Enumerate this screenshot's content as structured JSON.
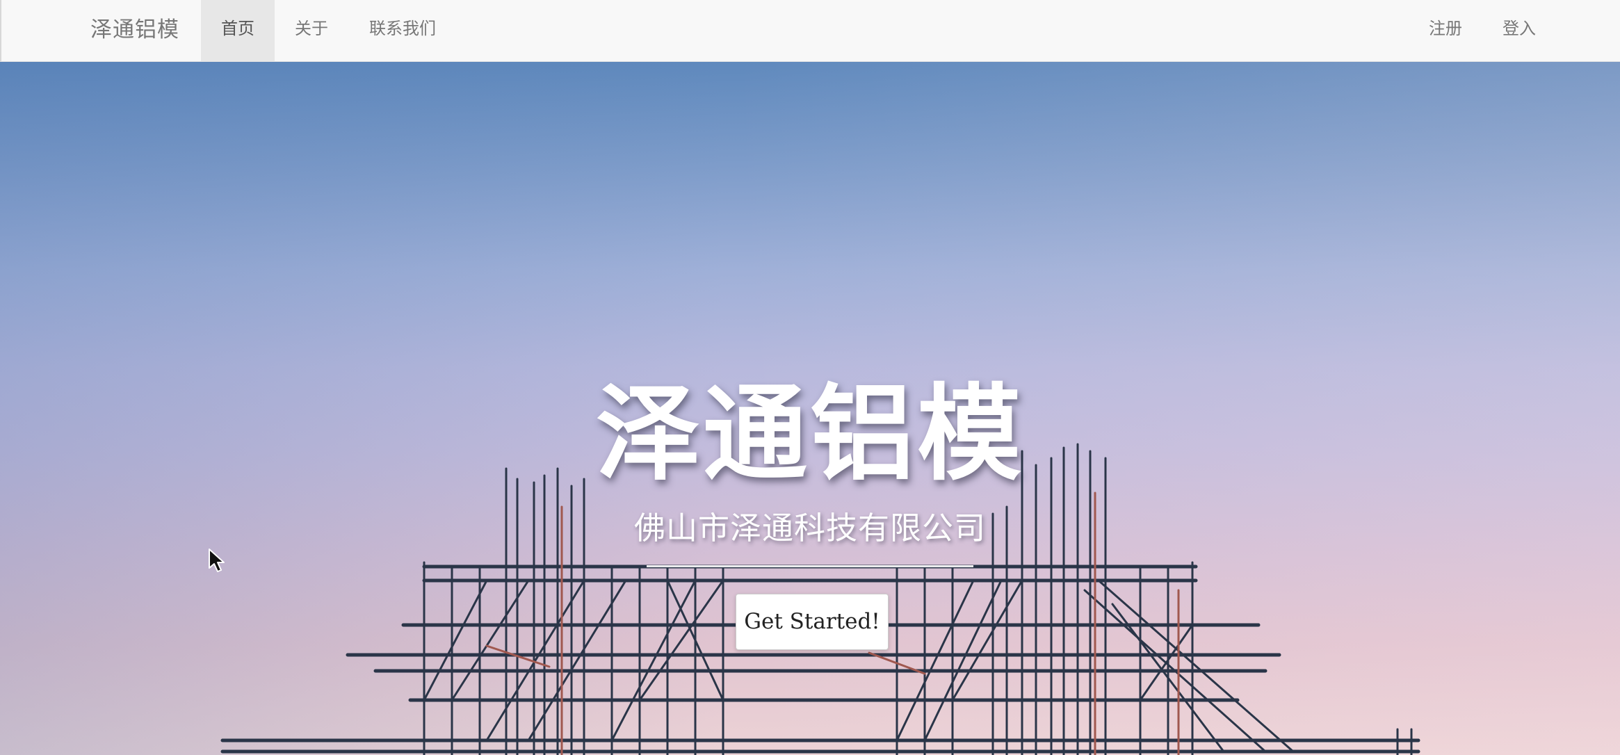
{
  "navbar": {
    "brand": "泽通铝模",
    "left_items": [
      {
        "label": "首页",
        "active": true
      },
      {
        "label": "关于",
        "active": false
      },
      {
        "label": "联系我们",
        "active": false
      }
    ],
    "right_items": [
      {
        "label": "注册"
      },
      {
        "label": "登入"
      }
    ]
  },
  "hero": {
    "title": "泽通铝模",
    "subtitle": "佛山市泽通科技有限公司",
    "cta_label": "Get Started!",
    "background_image": "scaffolding-against-dusk-sky"
  },
  "colors": {
    "navbar_bg": "#f8f8f8",
    "nav_text": "#777777",
    "nav_active_bg": "#e7e7e7",
    "sky_top": "#5f89bd",
    "sky_bottom": "#ecd3d6",
    "scaffold": "#2a3548"
  },
  "icons": {
    "cursor": "mouse-pointer-icon"
  }
}
